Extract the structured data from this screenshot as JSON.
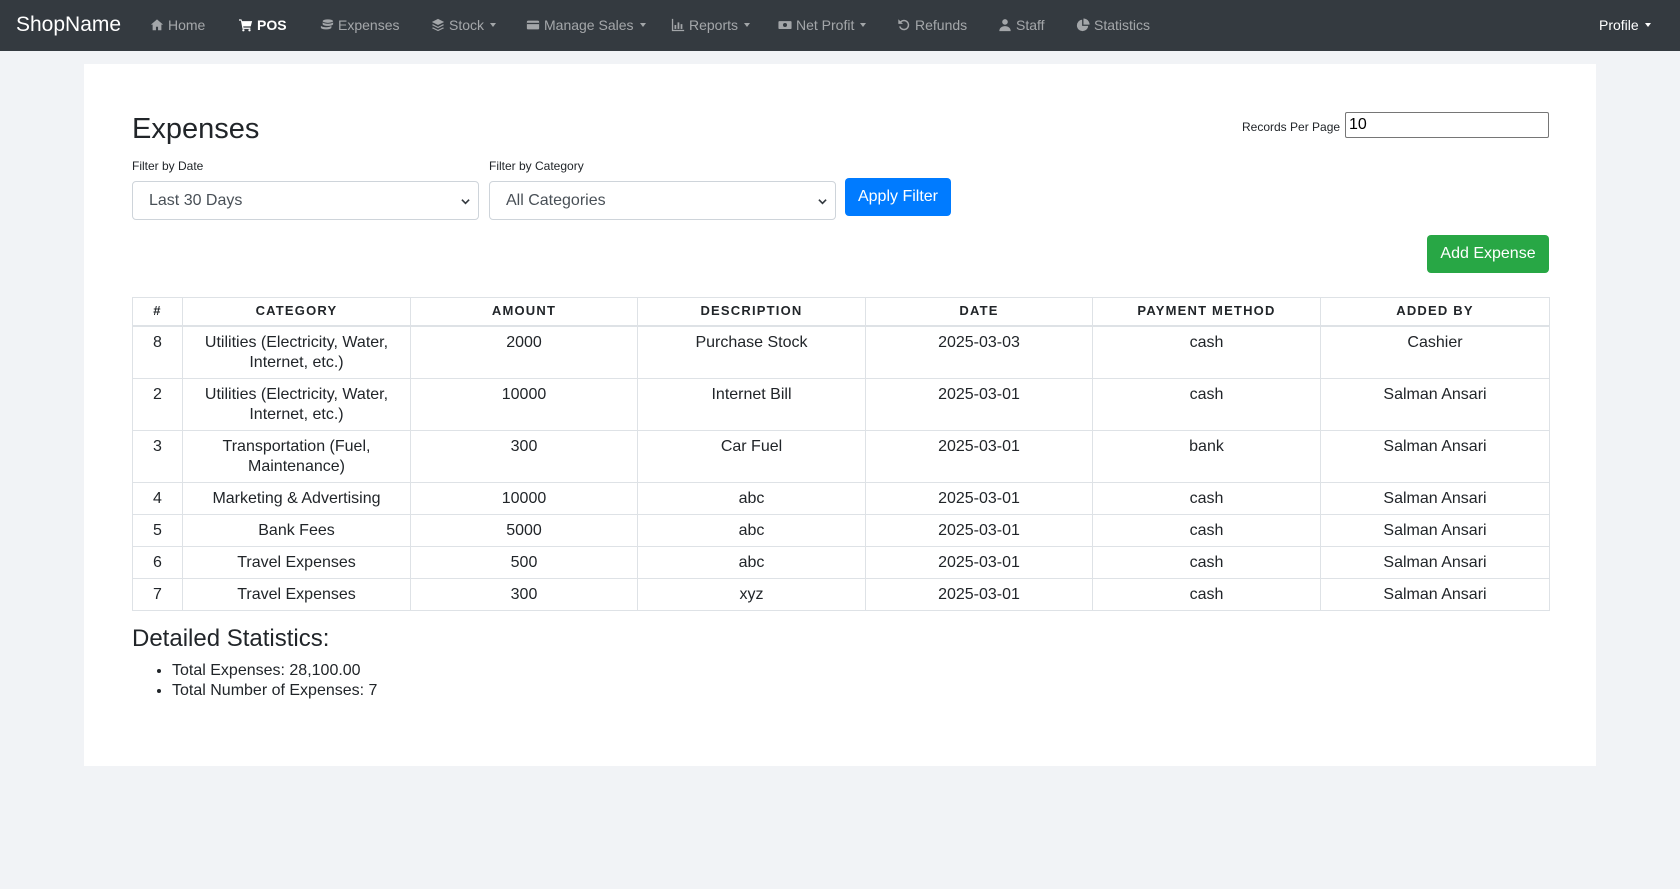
{
  "nav": {
    "brand": "ShopName",
    "items": [
      {
        "label": "Home",
        "icon": "home-icon"
      },
      {
        "label": "POS",
        "icon": "cart-icon",
        "active": true
      },
      {
        "label": "Expenses",
        "icon": "coins-icon"
      },
      {
        "label": "Stock",
        "icon": "layers-icon",
        "dropdown": true
      },
      {
        "label": "Manage Sales",
        "icon": "wallet-icon",
        "dropdown": true
      },
      {
        "label": "Reports",
        "icon": "chart-icon",
        "dropdown": true
      },
      {
        "label": "Net Profit",
        "icon": "money-icon",
        "dropdown": true
      },
      {
        "label": "Refunds",
        "icon": "undo-icon"
      },
      {
        "label": "Staff",
        "icon": "user-icon"
      },
      {
        "label": "Statistics",
        "icon": "pie-icon"
      }
    ],
    "profile": "Profile"
  },
  "page": {
    "title": "Expenses",
    "records_per_page_label": "Records Per Page",
    "records_per_page_value": "10"
  },
  "filters": {
    "date_label": "Filter by Date",
    "date_value": "Last 30 Days",
    "category_label": "Filter by Category",
    "category_value": "All Categories",
    "apply_label": "Apply Filter"
  },
  "actions": {
    "add_expense_label": "Add Expense"
  },
  "table": {
    "headers": [
      "#",
      "CATEGORY",
      "AMOUNT",
      "DESCRIPTION",
      "DATE",
      "PAYMENT METHOD",
      "ADDED BY"
    ],
    "rows": [
      [
        "8",
        "Utilities (Electricity, Water, Internet, etc.)",
        "2000",
        "Purchase Stock",
        "2025-03-03",
        "cash",
        "Cashier"
      ],
      [
        "2",
        "Utilities (Electricity, Water, Internet, etc.)",
        "10000",
        "Internet Bill",
        "2025-03-01",
        "cash",
        "Salman Ansari"
      ],
      [
        "3",
        "Transportation (Fuel, Maintenance)",
        "300",
        "Car Fuel",
        "2025-03-01",
        "bank",
        "Salman Ansari"
      ],
      [
        "4",
        "Marketing & Advertising",
        "10000",
        "abc",
        "2025-03-01",
        "cash",
        "Salman Ansari"
      ],
      [
        "5",
        "Bank Fees",
        "5000",
        "abc",
        "2025-03-01",
        "cash",
        "Salman Ansari"
      ],
      [
        "6",
        "Travel Expenses",
        "500",
        "abc",
        "2025-03-01",
        "cash",
        "Salman Ansari"
      ],
      [
        "7",
        "Travel Expenses",
        "300",
        "xyz",
        "2025-03-01",
        "cash",
        "Salman Ansari"
      ]
    ]
  },
  "stats": {
    "title": "Detailed Statistics:",
    "total_expenses": "Total Expenses: 28,100.00",
    "total_count": "Total Number of Expenses: 7"
  },
  "colors": {
    "navbar": "#343a40",
    "primary": "#007bff",
    "success": "#28a745",
    "page_bg": "#f1f3f6"
  }
}
